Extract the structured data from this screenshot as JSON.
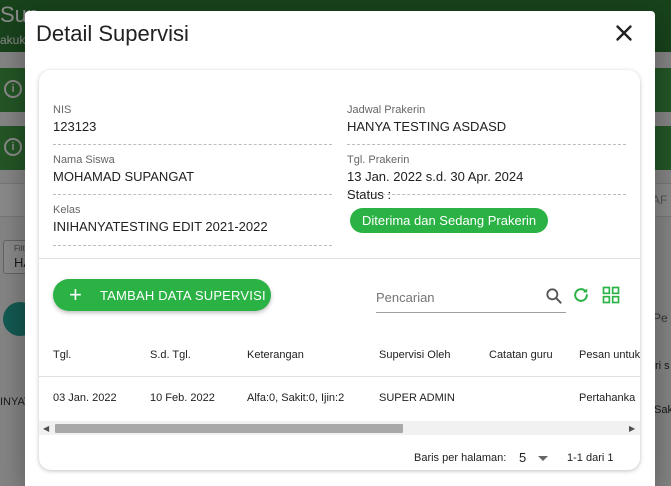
{
  "background": {
    "title_fragment": "Sup",
    "subtitle_fragment": "akuka",
    "field_label": "Filt",
    "field_value": "HA",
    "row_text": "INYAT",
    "right_a": "AF",
    "right_b": "Pe",
    "right_c": "ri s",
    "right_d": "Sak"
  },
  "dialog": {
    "title": "Detail Supervisi",
    "close_icon": "close-icon"
  },
  "info": {
    "nis_label": "NIS",
    "nis_value": "123123",
    "nama_label": "Nama Siswa",
    "nama_value": "MOHAMAD SUPANGAT",
    "kelas_label": "Kelas",
    "kelas_value": "INIHANYATESTING EDIT 2021-2022",
    "jadwal_label": "Jadwal Prakerin",
    "jadwal_value": "HANYA TESTING ASDASD",
    "tgl_label": "Tgl. Prakerin",
    "tgl_value": "13 Jan. 2022 s.d. 30 Apr. 2024",
    "status_label": "Status :",
    "status_value": "Diterima dan Sedang Prakerin",
    "status_color": "#2bb245"
  },
  "toolbar": {
    "add_label": "TAMBAH DATA SUPERVISI",
    "search_placeholder": "Pencarian",
    "search_icon": "search-icon",
    "refresh_icon": "refresh-icon",
    "grid_icon": "grid-view-icon",
    "accent": "#2bb245"
  },
  "table": {
    "headers": [
      "Tgl.",
      "S.d. Tgl.",
      "Keterangan",
      "Supervisi Oleh",
      "Catatan guru",
      "Pesan untuk"
    ],
    "rows": [
      [
        "03 Jan. 2022",
        "10 Feb. 2022",
        "Alfa:0, Sakit:0, Ijin:2",
        "SUPER ADMIN",
        "",
        "Pertahanka"
      ]
    ]
  },
  "pagination": {
    "rows_per_page_label": "Baris per halaman:",
    "rows_per_page_value": "5",
    "range": "1-1 dari 1"
  }
}
